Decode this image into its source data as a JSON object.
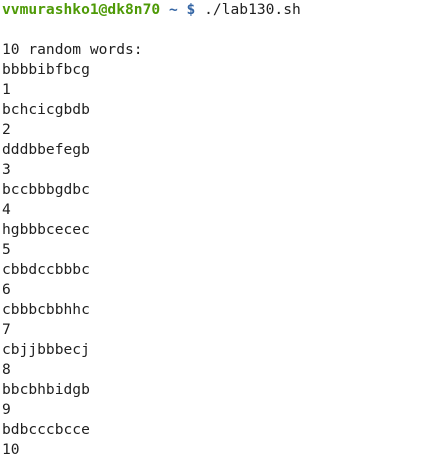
{
  "prompt": {
    "user_host": "vvmurashko1@dk8n70",
    "path": "~",
    "symbol": "$",
    "command": "./lab130.sh"
  },
  "colors": {
    "user_host": "#4e9a06",
    "path": "#3465a4",
    "text": "#1f1f1f",
    "background": "#ffffff"
  },
  "output": {
    "header": "10 random words:",
    "lines": [
      "bbbbibfbcg",
      "1",
      "bchcicgbdb",
      "2",
      "dddbbefegb",
      "3",
      "bccbbbgdbc",
      "4",
      "hgbbbcecec",
      "5",
      "cbbdccbbbc",
      "6",
      "cbbbcbbhhc",
      "7",
      "cbjjbbbecj",
      "8",
      "bbcbhbidgb",
      "9",
      "bdbcccbcce",
      "10"
    ]
  }
}
